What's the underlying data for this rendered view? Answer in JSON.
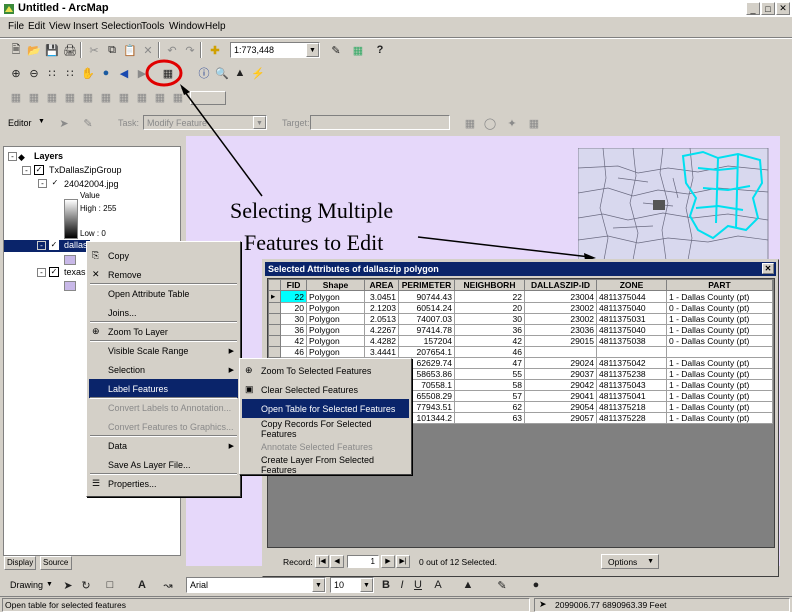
{
  "window": {
    "title": "Untitled - ArcMap"
  },
  "menu": [
    "File",
    "Edit",
    "View",
    "Insert",
    "Selection",
    "Tools",
    "Window",
    "Help"
  ],
  "toolbar": {
    "scale_value": "1:773,448"
  },
  "editor": {
    "label": "Editor",
    "task_label": "Task:",
    "task_value": "Modify Feature",
    "target_label": "Target:"
  },
  "toc": {
    "root_label": "Layers",
    "group_label": "TxDallasZipGroup",
    "raster_label": "24042004.jpg",
    "value_label": "Value",
    "high_label": "High : 255",
    "low_label": "Low : 0",
    "layer_selected": "dallas",
    "layer_texas": "texas",
    "tab_display": "Display",
    "tab_source": "Source"
  },
  "context_menu": {
    "items": [
      {
        "label": "Copy",
        "enabled": true
      },
      {
        "label": "Remove",
        "enabled": true
      },
      {
        "label": "Open Attribute Table",
        "enabled": true
      },
      {
        "label": "Joins...",
        "enabled": true
      },
      {
        "label": "Zoom To Layer",
        "enabled": true
      },
      {
        "label": "Visible Scale Range",
        "enabled": true,
        "submenu": true
      },
      {
        "label": "Selection",
        "enabled": true,
        "submenu": true
      },
      {
        "label": "Label Features",
        "enabled": true,
        "highlighted": true
      },
      {
        "label": "Convert Labels to Annotation...",
        "enabled": false
      },
      {
        "label": "Convert Features to Graphics...",
        "enabled": false
      },
      {
        "label": "Data",
        "enabled": true,
        "submenu": true
      },
      {
        "label": "Save As Layer File...",
        "enabled": true
      },
      {
        "label": "Properties...",
        "enabled": true
      }
    ]
  },
  "selection_submenu": {
    "items": [
      {
        "label": "Zoom To Selected Features",
        "enabled": true
      },
      {
        "label": "Clear Selected Features",
        "enabled": true
      },
      {
        "label": "Open Table for Selected Features",
        "enabled": true,
        "highlighted": true
      },
      {
        "label": "Copy Records For Selected Features",
        "enabled": true
      },
      {
        "label": "Annotate Selected Features",
        "enabled": false
      },
      {
        "label": "Create Layer From Selected Features",
        "enabled": true
      }
    ]
  },
  "attr_table": {
    "title": "Selected Attributes of dallaszip polygon",
    "columns": [
      "FID",
      "Shape",
      "AREA",
      "PERIMETER",
      "NEIGHBORH",
      "DALLASZIP-ID",
      "ZONE",
      "PART"
    ],
    "rows": [
      [
        "22",
        "Polygon",
        "3.0451",
        "90744.43",
        "22",
        "23004",
        "4811375044",
        "1 - Dallas County (pt)"
      ],
      [
        "20",
        "Polygon",
        "2.1203",
        "60514.24",
        "20",
        "23002",
        "4811375040",
        "0 - Dallas County (pt)"
      ],
      [
        "30",
        "Polygon",
        "2.0513",
        "74007.03",
        "30",
        "23002",
        "4811375031",
        "1 - Dallas County (pt)"
      ],
      [
        "36",
        "Polygon",
        "4.2267",
        "97414.78",
        "36",
        "23036",
        "4811375040",
        "1 - Dallas County (pt)"
      ],
      [
        "42",
        "Polygon",
        "4.4282",
        "157204",
        "42",
        "29015",
        "4811375038",
        "0 - Dallas County (pt)"
      ],
      [
        "46",
        "Polygon",
        "3.4441",
        "207654.1",
        "46",
        "",
        "",
        ""
      ],
      [
        "",
        "",
        "",
        "62629.74",
        "47",
        "29024",
        "4811375042",
        "1 - Dallas County (pt)"
      ],
      [
        "",
        "",
        "",
        "58653.86",
        "55",
        "29037",
        "4811375238",
        "1 - Dallas County (pt)"
      ],
      [
        "",
        "",
        "",
        "70558.1",
        "58",
        "29042",
        "4811375043",
        "1 - Dallas County (pt)"
      ],
      [
        "",
        "",
        "",
        "65508.29",
        "57",
        "29041",
        "4811375041",
        "1 - Dallas County (pt)"
      ],
      [
        "",
        "",
        "",
        "77943.51",
        "62",
        "29054",
        "4811375218",
        "1 - Dallas County (pt)"
      ],
      [
        "",
        "",
        "",
        "101344.2",
        "63",
        "29057",
        "4811375228",
        "1 - Dallas County (pt)"
      ]
    ],
    "record_label": "Record:",
    "record_value": "1",
    "status_text": "0 out of 12 Selected.",
    "options_label": "Options"
  },
  "annotation": {
    "line1": "Selecting Multiple",
    "line2": "Features to Edit"
  },
  "drawing_toolbar": {
    "drawing_label": "Drawing",
    "font_value": "Arial",
    "size_value": "10"
  },
  "status_bar": {
    "left_text": "Open table for selected features",
    "coords_text": "2099006.77 6890963.39 Feet"
  },
  "colors": {
    "map_bg": "#e6d8fa",
    "highlight": "#0a246a",
    "selected_feature": "#00ffff",
    "annot_circle": "#e00000"
  }
}
